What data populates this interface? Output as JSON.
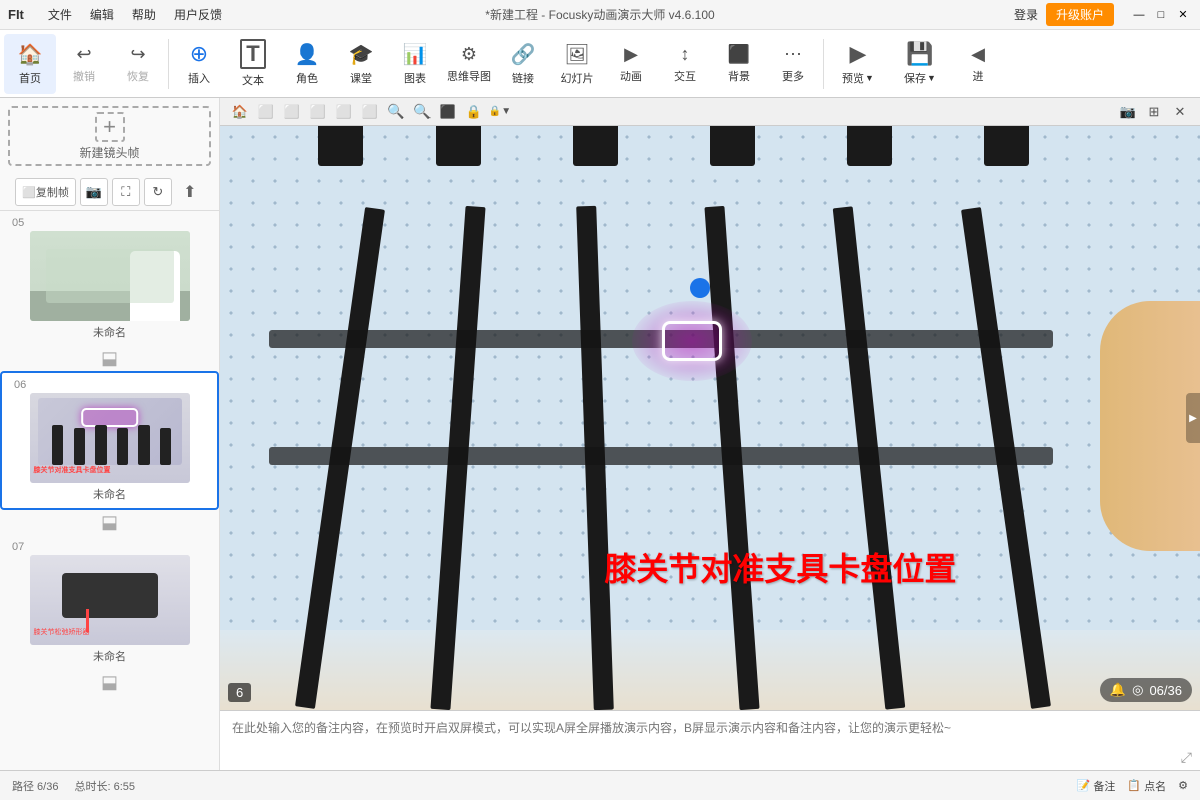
{
  "titlebar": {
    "logo": "FIt",
    "menu": [
      "文件",
      "编辑",
      "帮助",
      "用户反馈"
    ],
    "title": "*新建工程 - Focusky动画演示大师  v4.6.100",
    "login": "登录",
    "upgrade": "升级账户",
    "win_min": "—",
    "win_max": "□",
    "win_close": "✕"
  },
  "toolbar": {
    "items": [
      {
        "id": "home",
        "icon": "🏠",
        "label": "首页"
      },
      {
        "id": "undo",
        "icon": "↩",
        "label": "撤销"
      },
      {
        "id": "redo",
        "icon": "↪",
        "label": "恢复"
      },
      {
        "id": "insert",
        "icon": "⊕",
        "label": "插入"
      },
      {
        "id": "text",
        "icon": "T",
        "label": "文本"
      },
      {
        "id": "role",
        "icon": "👤",
        "label": "角色"
      },
      {
        "id": "class",
        "icon": "🎓",
        "label": "课堂"
      },
      {
        "id": "chart",
        "icon": "📊",
        "label": "图表"
      },
      {
        "id": "mindmap",
        "icon": "🔗",
        "label": "思维导图"
      },
      {
        "id": "link",
        "icon": "🔗",
        "label": "链接"
      },
      {
        "id": "slide",
        "icon": "🖼",
        "label": "幻灯片"
      },
      {
        "id": "animation",
        "icon": "▶",
        "label": "动画"
      },
      {
        "id": "interact",
        "icon": "👆",
        "label": "交互"
      },
      {
        "id": "background",
        "icon": "🖌",
        "label": "背景"
      },
      {
        "id": "more",
        "icon": "⋯",
        "label": "更多"
      },
      {
        "id": "preview",
        "icon": "▶",
        "label": "预览"
      },
      {
        "id": "save",
        "icon": "💾",
        "label": "保存"
      },
      {
        "id": "nav",
        "icon": "◀",
        "label": "进"
      }
    ]
  },
  "sidebar": {
    "new_frame_label": "新建镜头帧",
    "tools": [
      "复制帧",
      "📷",
      "⛶",
      "⟳",
      "⬆"
    ],
    "slides": [
      {
        "num": "05",
        "label": "未命名",
        "active": false
      },
      {
        "num": "06",
        "label": "未命名",
        "active": true
      },
      {
        "num": "07",
        "label": "未命名",
        "active": false
      }
    ]
  },
  "canvas": {
    "slide_text": "膝关节对准支具卡盘位置",
    "slide_num": "6",
    "progress": "06/36",
    "toolbar_icons": [
      "🏠",
      "⬜",
      "⬜",
      "⬜",
      "⬜",
      "⬜",
      "🔍+",
      "🔍-",
      "⬜",
      "🔒",
      "🔒",
      "📷",
      "⬜",
      "✕"
    ]
  },
  "notes": {
    "placeholder": "在此处输入您的备注内容，在预览时开启双屏模式，可以实现A屏全屏播放演示内容，B屏显示演示内容和备注内容，让您的演示更轻松~"
  },
  "statusbar": {
    "path": "路径 6/36",
    "duration": "总时长: 6:55",
    "notes_btn": "备注",
    "rename_btn": "点名"
  }
}
